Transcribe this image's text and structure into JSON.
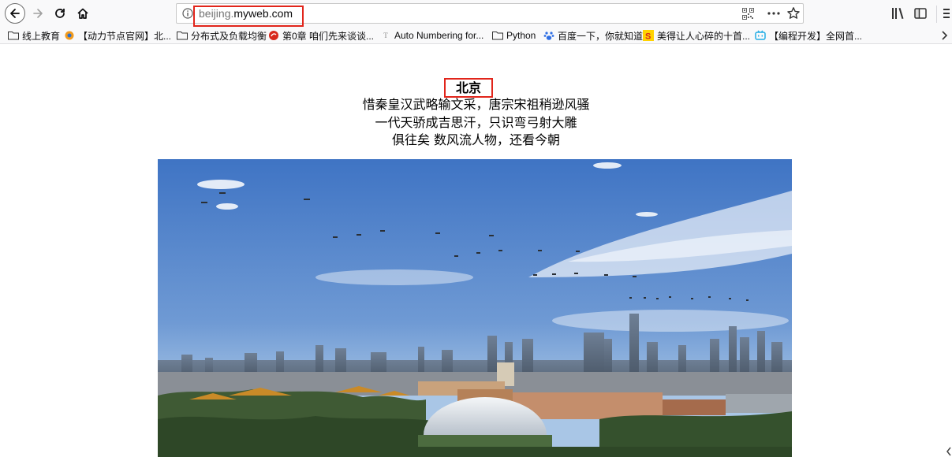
{
  "browser": {
    "url_domain_muted": "beijing.",
    "url_domain_main": "myweb.com"
  },
  "bookmarks": [
    {
      "label": "线上教育",
      "icon": "folder-icon"
    },
    {
      "label": "【动力节点官网】北...",
      "icon": "site-logo-icon"
    },
    {
      "label": "分布式及负载均衡",
      "icon": "folder-icon"
    },
    {
      "label": "第0章 咱们先来谈谈...",
      "icon": "red-site-icon"
    },
    {
      "label": "Auto Numbering for...",
      "icon": "text-site-icon"
    },
    {
      "label": "Python",
      "icon": "folder-icon"
    },
    {
      "label": "百度一下，你就知道",
      "icon": "baidu-paw-icon"
    },
    {
      "label": "美得让人心碎的十首...",
      "icon": "sohu-icon"
    },
    {
      "label": "【编程开发】全网首...",
      "icon": "bilibili-tv-icon"
    }
  ],
  "page": {
    "title": "北京",
    "lines": [
      "惜秦皇汉武略输文采，唐宗宋祖稍逊风骚",
      "一代天骄成吉思汗，只识弯弓射大雕",
      "俱往矣 数风流人物，还看今朝"
    ]
  },
  "colors": {
    "highlight_red": "#e1251b",
    "sky_top": "#3f74c4",
    "sky_bottom": "#a9c6e6"
  }
}
